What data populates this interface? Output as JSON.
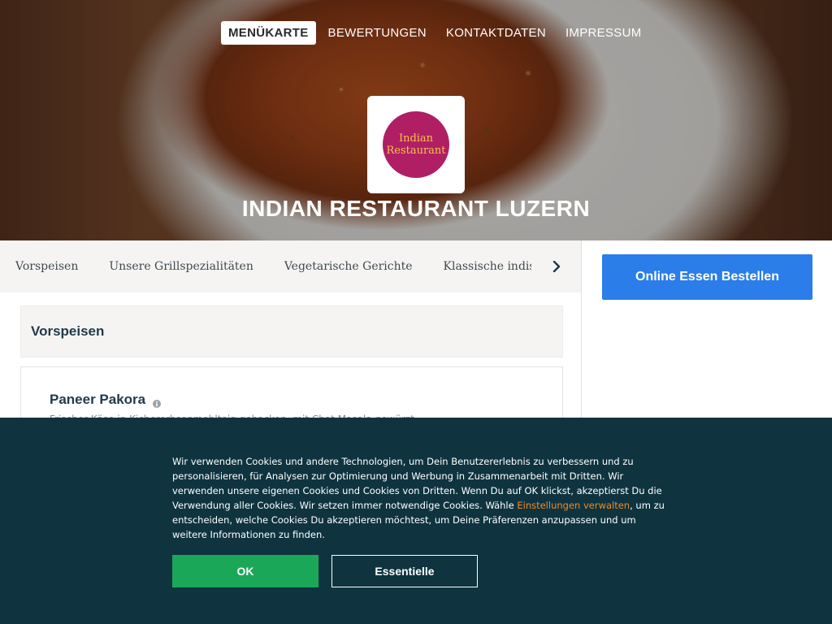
{
  "nav": {
    "items": [
      {
        "label": "MENÜKARTE",
        "active": true
      },
      {
        "label": "BEWERTUNGEN",
        "active": false
      },
      {
        "label": "KONTAKTDATEN",
        "active": false
      },
      {
        "label": "IMPRESSUM",
        "active": false
      }
    ]
  },
  "logo": {
    "line1": "Indian",
    "line2": "Restaurant"
  },
  "restaurant": {
    "title": "INDIAN RESTAURANT LUZERN"
  },
  "categories": [
    "Vorspeisen",
    "Unsere Grillspezialitäten",
    "Vegetarische Gerichte",
    "Klassische indische Gerichte"
  ],
  "icons": {
    "next": "chevron-right-icon",
    "info": "info-icon"
  },
  "menu": {
    "section_title": "Vorspeisen",
    "dish": {
      "name": "Paneer Pakora",
      "description": "Frischer Käse in Kichererbsenmehlteig gebacken, mit Chat Masala gewürzt"
    }
  },
  "sidebar": {
    "order_button": "Online Essen Bestellen"
  },
  "cookie": {
    "text_before_link": "Wir verwenden Cookies und andere Technologien, um Dein Benutzererlebnis zu verbessern und zu personalisieren, für Analysen zur Optimierung und Werbung in Zusammenarbeit mit Dritten. Wir verwenden unsere eigenen Cookies und Cookies von Dritten. Wenn Du auf OK klickst, akzeptierst Du die Verwendung aller Cookies. Wir setzen immer notwendige Cookies. Wähle ",
    "link": "Einstellungen verwalten",
    "text_after_link": ", um zu entscheiden, welche Cookies Du akzeptieren möchtest, um Deine Präferenzen anzupassen und um weitere Informationen zu finden.",
    "ok_button": "OK",
    "essential_button": "Essentielle"
  },
  "colors": {
    "brand_blue": "#2b7de9",
    "cookie_bg": "#0f3440",
    "ok_green": "#1aa858",
    "link_orange": "#f08a24",
    "logo_magenta": "#b01f63",
    "logo_gold": "#f5c24a"
  }
}
